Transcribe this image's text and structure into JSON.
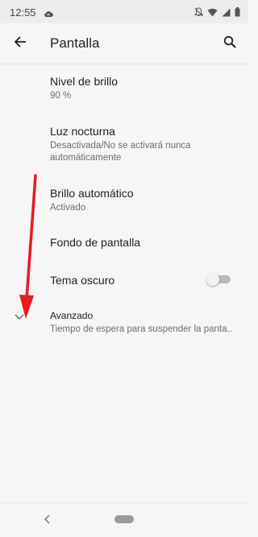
{
  "status_bar": {
    "time": "12:55",
    "icons": [
      "cloud-icon",
      "notifications-off-icon",
      "wifi-icon",
      "signal-icon",
      "battery-icon"
    ]
  },
  "app_bar": {
    "title": "Pantalla",
    "back_icon": "arrow-back-icon",
    "search_icon": "search-icon"
  },
  "settings": [
    {
      "title": "Nivel de brillo",
      "summary": "90 %"
    },
    {
      "title": "Luz nocturna",
      "summary": "Desactivada/No se activará nunca automáticamente"
    },
    {
      "title": "Brillo automático",
      "summary": "Activado"
    },
    {
      "title": "Fondo de pantalla",
      "summary": ""
    },
    {
      "title": "Tema oscuro",
      "summary": "",
      "toggle_on": false
    },
    {
      "title": "Avanzado",
      "summary": "Tiempo de espera para suspender la panta.."
    }
  ],
  "colors": {
    "background": "#f6f6f6",
    "annotation_arrow": "#e8191f"
  }
}
